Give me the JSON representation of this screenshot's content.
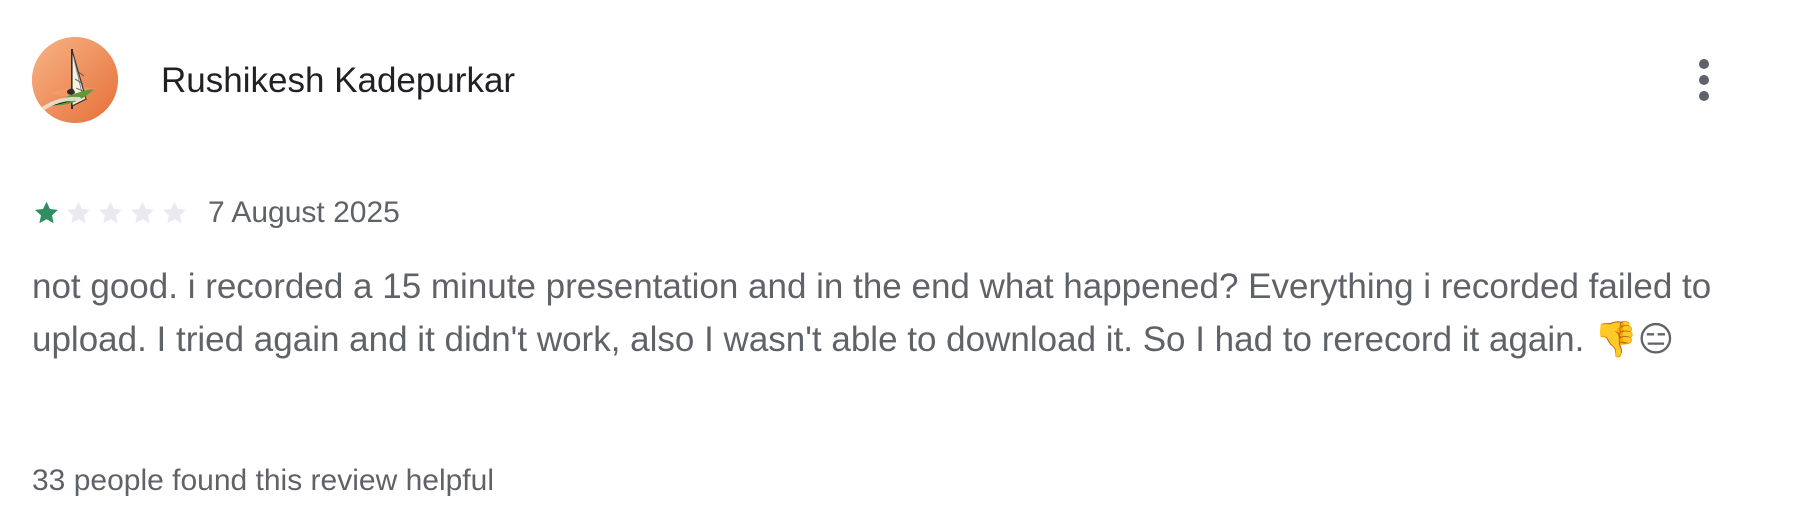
{
  "review": {
    "reviewer_name": "Rushikesh Kadepurkar",
    "avatar_icon": "windsurfer-avatar-icon",
    "menu_icon": "more-vert-icon",
    "rating": 1,
    "rating_max": 5,
    "date": "7 August 2025",
    "text": "not good. i recorded a 15 minute presentation and in the end what happened? Everything i recorded failed to upload. I tried again and it didn't work, also I wasn't able to download it. So I had to rerecord it again. 👎😑",
    "emoji_names": [
      "thumbs-down-emoji",
      "expressionless-face-emoji"
    ],
    "helpful_text": "33 people found this review helpful"
  },
  "colors": {
    "filled_star": "#2f8f63",
    "empty_star": "#e8eaed",
    "primary_text": "#202124",
    "secondary_text": "#5f6368",
    "avatar_bg": "#ee8b54"
  }
}
